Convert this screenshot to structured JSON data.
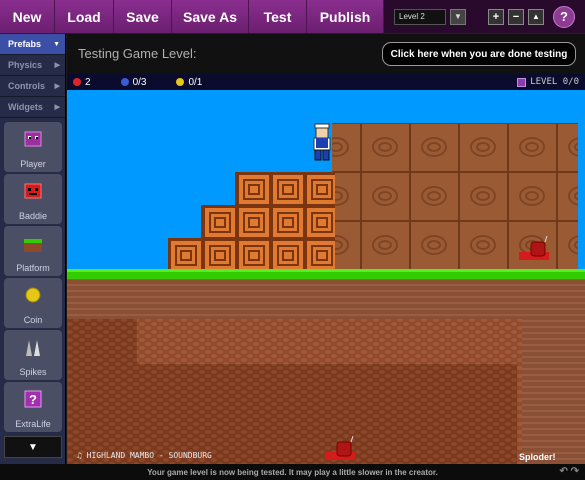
{
  "toolbar": {
    "new": "New",
    "load": "Load",
    "save": "Save",
    "save_as": "Save As",
    "test": "Test",
    "publish": "Publish",
    "level_select": "Level 2",
    "plus": "+",
    "minus": "−",
    "up": "▲",
    "help": "?"
  },
  "sidebar": {
    "tabs": [
      {
        "label": "Prefabs",
        "active": true
      },
      {
        "label": "Physics",
        "active": false
      },
      {
        "label": "Controls",
        "active": false
      },
      {
        "label": "Widgets",
        "active": false
      }
    ],
    "items": [
      {
        "label": "Player",
        "icon": "player-icon"
      },
      {
        "label": "Baddie",
        "icon": "baddie-icon"
      },
      {
        "label": "Platform",
        "icon": "platform-icon"
      },
      {
        "label": "Coin",
        "icon": "coin-icon"
      },
      {
        "label": "Spikes",
        "icon": "spikes-icon"
      },
      {
        "label": "ExtraLife",
        "icon": "extralife-icon"
      }
    ],
    "scroll_down": "▼"
  },
  "test_header": {
    "title": "Testing Game Level:",
    "done_button": "Click here when you are done testing"
  },
  "hud": {
    "lives": "2",
    "orbs": "0/3",
    "coins": "0/1",
    "level": "LEVEL 0/0"
  },
  "game": {
    "music": "♫ HIGHLAND MAMBO - SOUNDBURG",
    "brand": "Sploder!"
  },
  "status": "Your game level is now being tested. It may play a little slower in the creator.",
  "colors": {
    "toolbar": "#7a2880",
    "sky": "#0099ff",
    "grass": "#33cc00",
    "dirt": "#8c4a2a",
    "crate": "#e07a30"
  }
}
